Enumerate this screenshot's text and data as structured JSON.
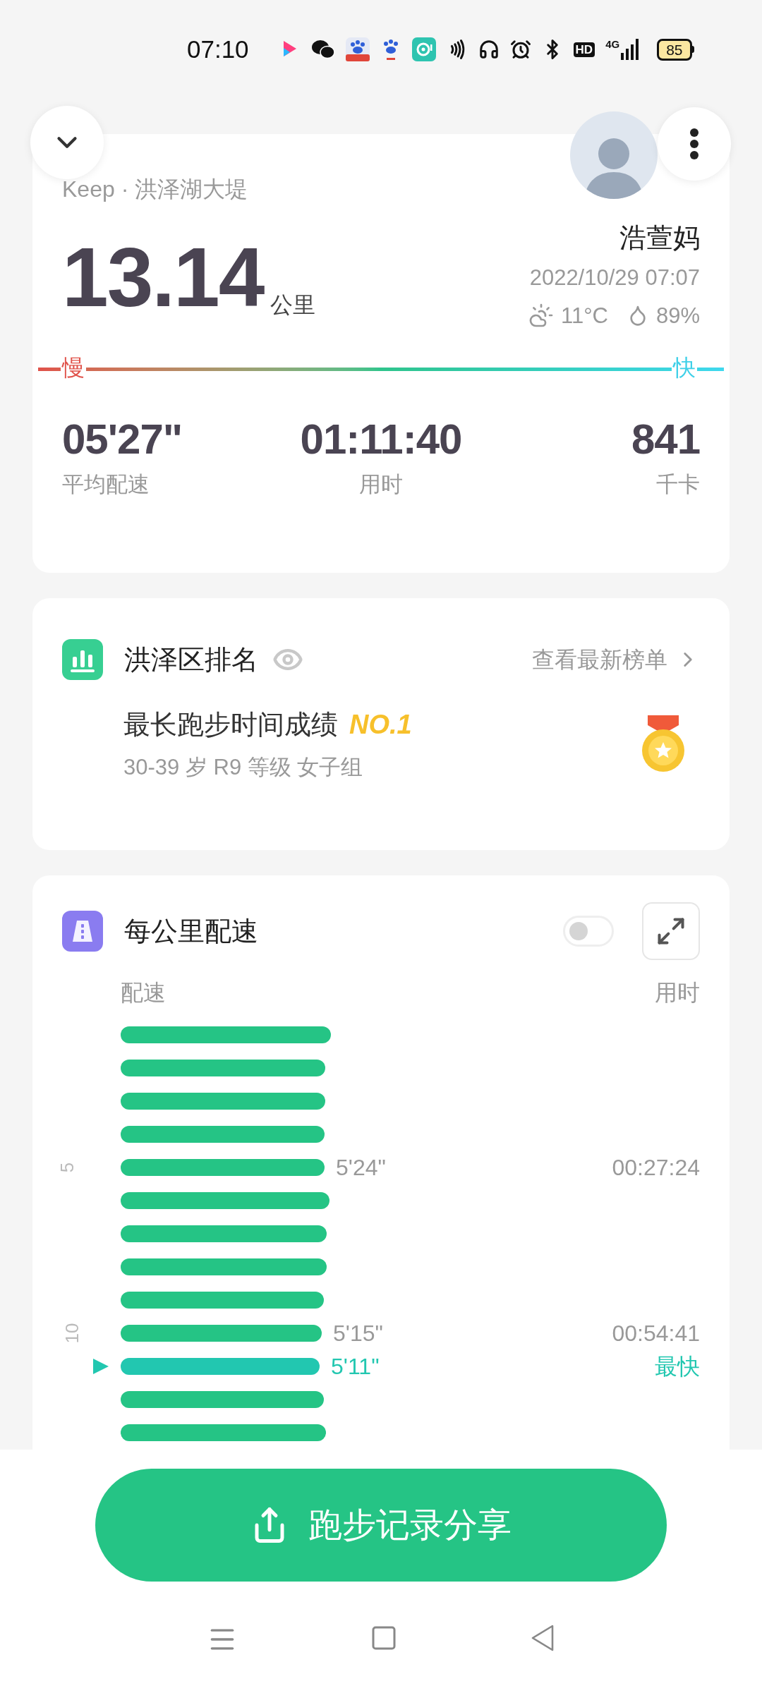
{
  "status_bar": {
    "time": "07:10",
    "hd_label": "HD",
    "network": "4G",
    "battery": "85"
  },
  "summary": {
    "source": "Keep · 洪泽湖大堤",
    "distance": "13.14",
    "distance_unit": "公里",
    "user_name": "浩萱妈",
    "datetime": "2022/10/29 07:07",
    "temperature": "11°C",
    "humidity": "89%",
    "slow_label": "慢",
    "fast_label": "快",
    "stats": [
      {
        "value": "05'27\"",
        "label": "平均配速"
      },
      {
        "value": "01:11:40",
        "label": "用时"
      },
      {
        "value": "841",
        "label": "千卡"
      }
    ]
  },
  "ranking": {
    "title": "洪泽区排名",
    "link": "查看最新榜单",
    "achievement": "最长跑步时间成绩",
    "rank": "NO.1",
    "group": "30-39 岁 R9 等级 女子组"
  },
  "pace_chart": {
    "title": "每公里配速",
    "toggle_on": false,
    "pace_header": "配速",
    "time_header": "用时",
    "rows": [
      {
        "fastest": false
      },
      {
        "fastest": false
      },
      {
        "fastest": false
      },
      {
        "fastest": false
      },
      {
        "km": "5",
        "pace": "5'24\"",
        "time": "00:27:24",
        "fastest": false
      },
      {
        "fastest": false
      },
      {
        "fastest": false
      },
      {
        "fastest": false
      },
      {
        "fastest": false
      },
      {
        "km": "10",
        "pace": "5'15\"",
        "time": "00:54:41",
        "fastest": false
      },
      {
        "pace": "5'11\"",
        "time": "最快",
        "fastest": true
      },
      {
        "fastest": false
      },
      {
        "fastest": false
      }
    ]
  },
  "share_button": "跑步记录分享"
}
